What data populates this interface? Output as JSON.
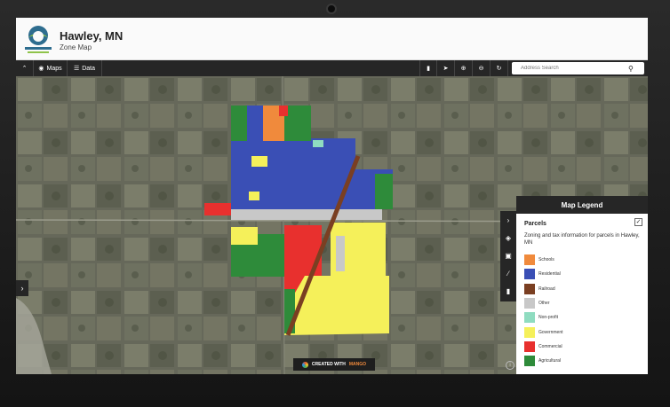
{
  "header": {
    "title": "Hawley, MN",
    "subtitle": "Zone Map"
  },
  "toolbar": {
    "collapse_icon": "chevron-up-icon",
    "maps_label": "Maps",
    "data_label": "Data"
  },
  "search": {
    "placeholder": "Address Search"
  },
  "legend": {
    "title": "Map Legend",
    "layer_title": "Parcels",
    "layer_description": "Zoning and tax information for parcels in Hawley, MN",
    "items": [
      {
        "label": "Schools",
        "color": "#f08a3c"
      },
      {
        "label": "Residential",
        "color": "#3a4fb5"
      },
      {
        "label": "Railroad",
        "color": "#7a3f22"
      },
      {
        "label": "Other",
        "color": "#c8c8c8"
      },
      {
        "label": "Non-profit",
        "color": "#8fdcc0"
      },
      {
        "label": "Government",
        "color": "#f5f05a"
      },
      {
        "label": "Commercial",
        "color": "#e8302e"
      },
      {
        "label": "Agricultural",
        "color": "#2e8b3a"
      }
    ]
  },
  "badge": {
    "label": "CREATED WITH",
    "brand": "MANGO",
    "brand_color": "#f08a3c"
  },
  "colors": {
    "toolbar": "#262626",
    "imagery_base": "#66685a"
  }
}
